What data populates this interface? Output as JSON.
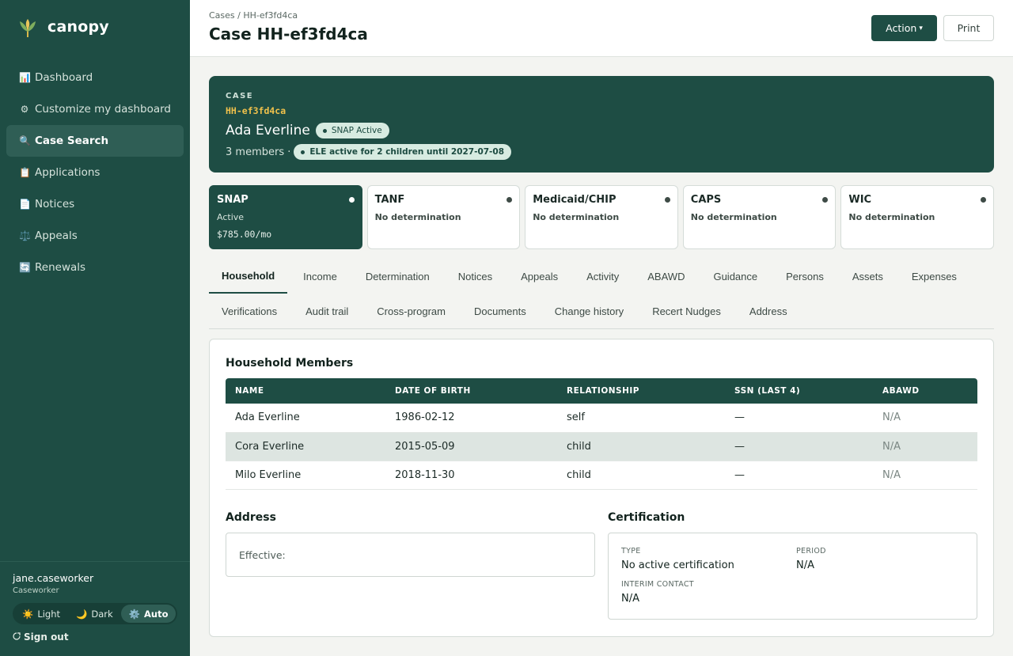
{
  "brand": {
    "name": "canopy"
  },
  "sidebar": {
    "items": [
      {
        "icon": "📊",
        "label": "Dashboard",
        "active": false
      },
      {
        "icon": "⚙",
        "label": "Customize my dashboard",
        "active": false
      },
      {
        "icon": "🔍",
        "label": "Case Search",
        "active": true
      },
      {
        "icon": "📋",
        "label": "Applications",
        "active": false
      },
      {
        "icon": "📄",
        "label": "Notices",
        "active": false
      },
      {
        "icon": "⚖️",
        "label": "Appeals",
        "active": false
      },
      {
        "icon": "🔄",
        "label": "Renewals",
        "active": false
      }
    ],
    "user": {
      "name": "jane.caseworker",
      "role": "Caseworker"
    },
    "theme": {
      "light": "Light",
      "dark": "Dark",
      "auto": "Auto",
      "light_icon": "☀️",
      "dark_icon": "🌙",
      "auto_icon": "⚙️"
    },
    "signout": "Sign out"
  },
  "header": {
    "breadcrumb": "Cases / HH-ef3fd4ca",
    "title": "Case HH-ef3fd4ca",
    "action_label": "Action",
    "action_caret": "▾",
    "print_label": "Print"
  },
  "case": {
    "eyebrow": "CASE",
    "id": "HH-ef3fd4ca",
    "name": "Ada Everline",
    "status_pill": "SNAP Active",
    "members_text": "3 members ·",
    "ele_pill": "ELE active for 2 children until 2027-07-08"
  },
  "programs": [
    {
      "name": "SNAP",
      "status": "Active",
      "amount": "$785.00/mo",
      "active": true
    },
    {
      "name": "TANF",
      "status": "No determination",
      "amount": "",
      "active": false
    },
    {
      "name": "Medicaid/CHIP",
      "status": "No determination",
      "amount": "",
      "active": false
    },
    {
      "name": "CAPS",
      "status": "No determination",
      "amount": "",
      "active": false
    },
    {
      "name": "WIC",
      "status": "No determination",
      "amount": "",
      "active": false
    }
  ],
  "tabs": {
    "row1": [
      "Household",
      "Income",
      "Determination",
      "Notices",
      "Appeals",
      "Activity",
      "ABAWD",
      "Guidance",
      "Persons",
      "Assets",
      "Expenses"
    ],
    "row2": [
      "Verifications",
      "Audit trail",
      "Cross-program",
      "Documents",
      "Change history",
      "Recert Nudges",
      "Address"
    ],
    "active": "Household"
  },
  "household": {
    "title": "Household Members",
    "columns": [
      "NAME",
      "DATE OF BIRTH",
      "RELATIONSHIP",
      "SSN (LAST 4)",
      "ABAWD"
    ],
    "rows": [
      [
        "Ada Everline",
        "1986-02-12",
        "self",
        "—",
        "N/A"
      ],
      [
        "Cora Everline",
        "2015-05-09",
        "child",
        "—",
        "N/A"
      ],
      [
        "Milo Everline",
        "2018-11-30",
        "child",
        "—",
        "N/A"
      ]
    ]
  },
  "address": {
    "title": "Address",
    "effective_label": "Effective:"
  },
  "certification": {
    "title": "Certification",
    "type_label": "TYPE",
    "type_value": "No active certification",
    "period_label": "PERIOD",
    "period_value": "N/A",
    "interim_label": "INTERIM CONTACT",
    "interim_value": "N/A"
  },
  "colors": {
    "primary": "#1e4d44",
    "accent": "#f0c14b",
    "pill_bg": "#d7ebe1"
  }
}
